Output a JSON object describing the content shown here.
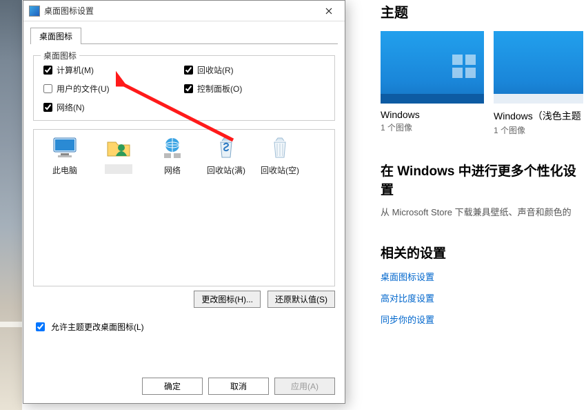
{
  "dialog": {
    "title": "桌面图标设置",
    "tab": "桌面图标",
    "group_legend": "桌面图标",
    "checks": {
      "computer": {
        "label": "计算机(M)",
        "checked": true
      },
      "userfiles": {
        "label": "用户的文件(U)",
        "checked": false
      },
      "network": {
        "label": "网络(N)",
        "checked": true
      },
      "recyclebin": {
        "label": "回收站(R)",
        "checked": true
      },
      "controlpanel": {
        "label": "控制面板(O)",
        "checked": true
      }
    },
    "icons": {
      "thispc": "此电脑",
      "user": "",
      "network": "网络",
      "rb_full": "回收站(满)",
      "rb_empty": "回收站(空)"
    },
    "change_icon_btn": "更改图标(H)...",
    "restore_btn": "还原默认值(S)",
    "allow_themes": {
      "label": "允许主题更改桌面图标(L)",
      "checked": true
    },
    "ok": "确定",
    "cancel": "取消",
    "apply": "应用(A)"
  },
  "right": {
    "themes_h": "主题",
    "theme1": {
      "name": "Windows",
      "sub": "1 个图像"
    },
    "theme2": {
      "name": "Windows（浅色主题",
      "sub": "1 个图像"
    },
    "more_h": "在 Windows 中进行更多个性化设置",
    "more_sub": "从 Microsoft Store 下载兼具壁纸、声音和颜色的",
    "related_h": "相关的设置",
    "link1": "桌面图标设置",
    "link2": "高对比度设置",
    "link3": "同步你的设置"
  }
}
